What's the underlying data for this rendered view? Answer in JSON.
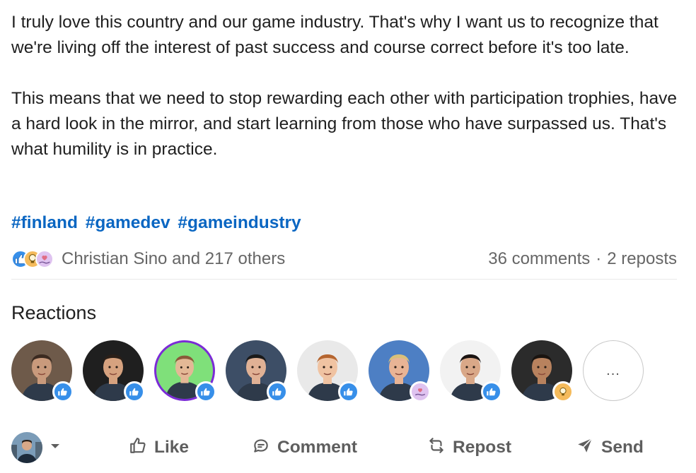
{
  "post": {
    "paragraphs": [
      "I truly love this country and our game industry. That's why I want us to recognize that we're living off the interest of past success and course correct before it's too late.",
      "This means that we need to stop rewarding each other with participation trophies, have a hard look in the mirror, and start learning from those who have surpassed us. That's what humility is in practice."
    ],
    "hashtags": [
      "#finland",
      "#gamedev",
      "#gameindustry"
    ]
  },
  "social": {
    "reaction_types": [
      "like-icon",
      "insightful-icon",
      "support-icon"
    ],
    "likers_text": "Christian Sino and 217 others",
    "comments": "36 comments",
    "separator": "·",
    "reposts": "2 reposts"
  },
  "reactions": {
    "title": "Reactions",
    "people": [
      {
        "reaction": "like",
        "skin": "#c99a7c",
        "hair": "#3b2a20",
        "bg": "#6e5a4a"
      },
      {
        "reaction": "like",
        "skin": "#d6a27f",
        "hair": "#2a1f18",
        "bg": "#1f1f1f"
      },
      {
        "reaction": "like",
        "skin": "#e3b896",
        "hair": "#8a5a3a",
        "bg": "#7fe07a"
      },
      {
        "reaction": "like",
        "skin": "#e0b195",
        "hair": "#1a1a1a",
        "bg": "#3d4e66"
      },
      {
        "reaction": "like",
        "skin": "#f0c3a2",
        "hair": "#b5652f",
        "bg": "#e9e9e9"
      },
      {
        "reaction": "support",
        "skin": "#e8b495",
        "hair": "#d9c07a",
        "bg": "#4d7fc4"
      },
      {
        "reaction": "like",
        "skin": "#d9a888",
        "hair": "#1b1412",
        "bg": "#f2f2f2"
      },
      {
        "reaction": "insight",
        "skin": "#b8825e",
        "hair": "#1a1410",
        "bg": "#2b2b2b"
      }
    ],
    "more_label": "..."
  },
  "actions": {
    "like": "Like",
    "comment": "Comment",
    "repost": "Repost",
    "send": "Send"
  },
  "colors": {
    "accent": "#0a66c2",
    "like_blue": "#378fe9",
    "insight_gold": "#f5bb5c",
    "support_purple": "#dfc3f0",
    "muted": "#666666"
  }
}
